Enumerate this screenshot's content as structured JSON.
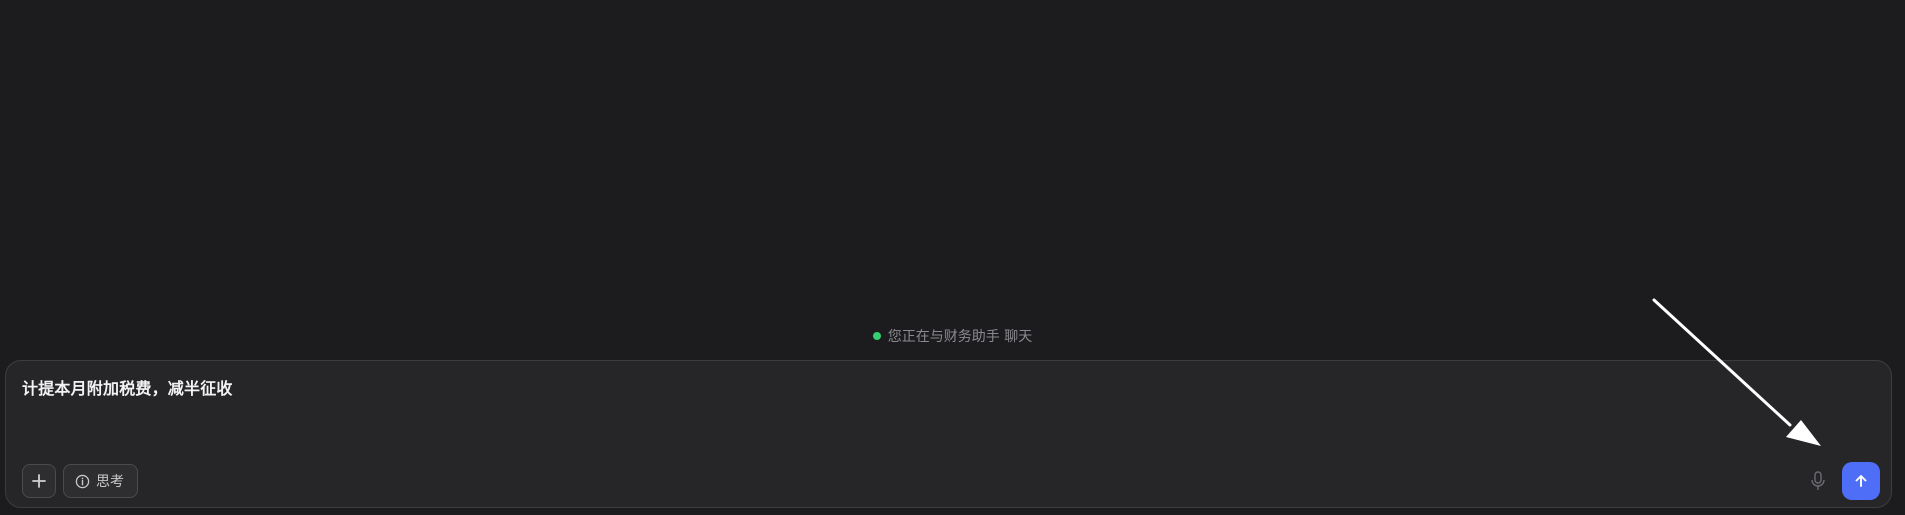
{
  "status": {
    "text": "您正在与财务助手 聊天",
    "dot_color": "#34d070"
  },
  "composer": {
    "input_value": "计提本月附加税费，减半征收",
    "attach_icon": "plus-icon",
    "think_label": "思考",
    "think_icon": "info-circle-icon",
    "mic_icon": "microphone-icon",
    "send_icon": "arrow-up-icon",
    "send_color": "#4f6ef7"
  },
  "annotation": {
    "icon": "pointer-arrow-icon",
    "color": "#ffffff"
  }
}
